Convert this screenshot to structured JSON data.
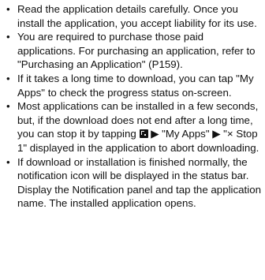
{
  "bullet_glyph": "•",
  "items": [
    {
      "text": "Read the application details carefully. Once you install the application, you accept liability for its use."
    },
    {
      "text": "You are required to purchase those paid applications. For purchasing an application, refer to \"Purchasing an Application\" (P159)."
    },
    {
      "text": "If it takes a long time to download, you can tap \"My Apps\" to check the progress status on-screen."
    },
    {
      "text_before_icon": "Most applications can be installed in a few seconds, but, if the download does not end after a long time, you can stop it by tapping ",
      "icon": "menu-key-icon",
      "text_after_icon": " ▶ \"My Apps\" ▶ \"× Stop 1\" displayed in the application to abort downloading."
    },
    {
      "text": "If download or installation is finished normally, the notification icon will be displayed in the status bar. Display the Notification panel and tap the application name. The installed application opens."
    }
  ]
}
